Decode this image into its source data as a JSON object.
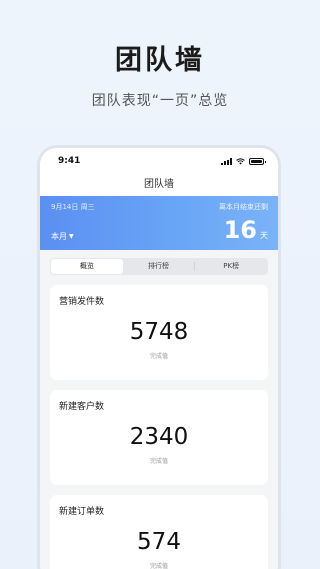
{
  "hero": {
    "title": "团队墙",
    "subtitle": "团队表现“一页”总览"
  },
  "status_bar": {
    "time": "9:41",
    "icons": [
      "signal-icon",
      "wifi-icon",
      "battery-icon"
    ]
  },
  "nav": {
    "title": "团队墙"
  },
  "banner": {
    "date": "9月14日 周三",
    "remaining_label": "离本月结束还剩",
    "period": "本月",
    "days": "16",
    "days_unit": "天",
    "gradient_colors": [
      "#5b8ff2",
      "#7ab3f7"
    ]
  },
  "tabs": [
    {
      "label": "概览",
      "active": true
    },
    {
      "label": "排行榜",
      "active": false
    },
    {
      "label": "PK榜",
      "active": false
    }
  ],
  "cards": [
    {
      "title": "营销发件数",
      "value": "5748",
      "caption": "完成值"
    },
    {
      "title": "新建客户数",
      "value": "2340",
      "caption": "完成值"
    },
    {
      "title": "新建订单数",
      "value": "574",
      "caption": "完成值"
    }
  ]
}
